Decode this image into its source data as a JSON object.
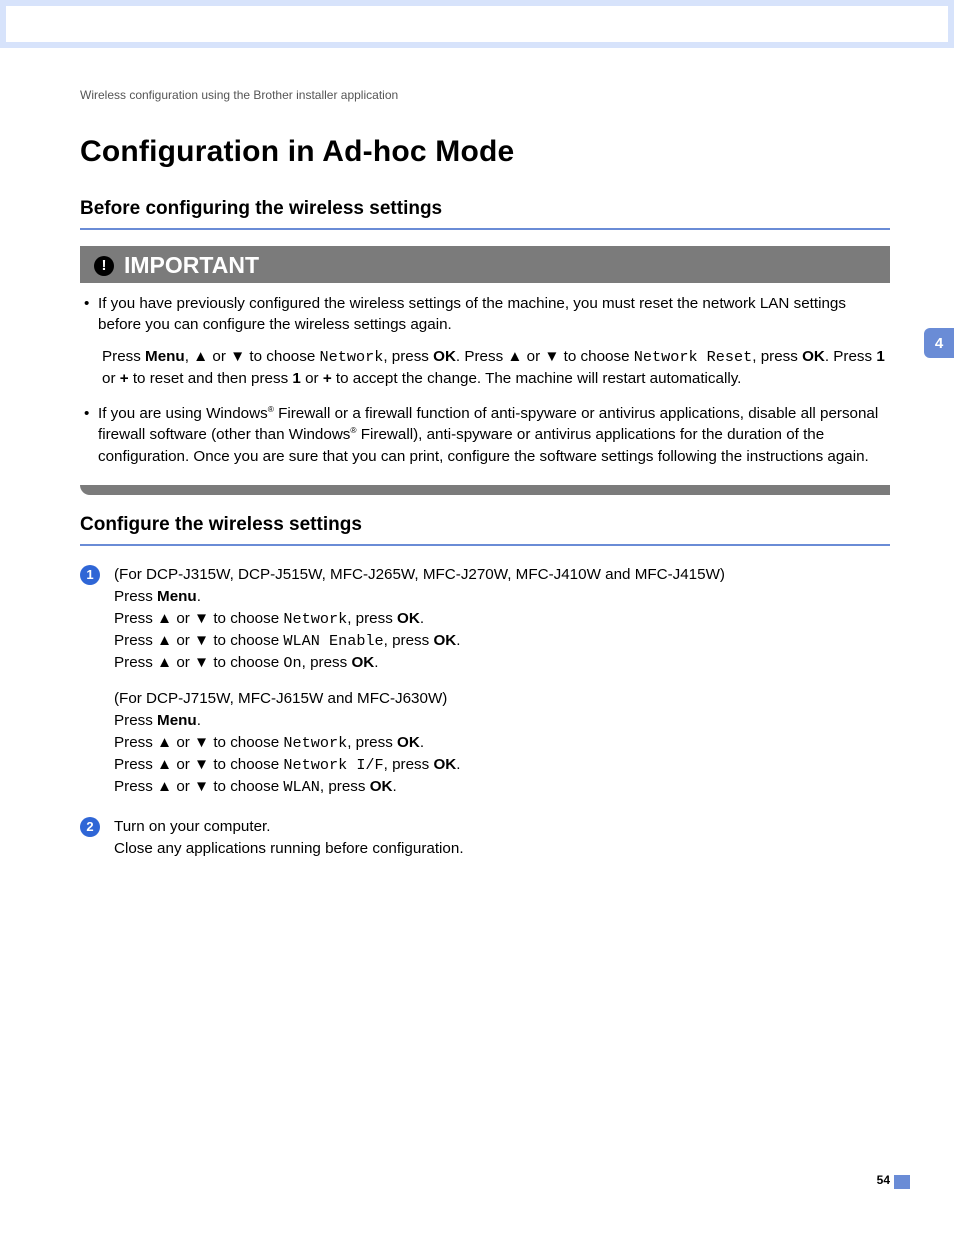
{
  "breadcrumb": "Wireless configuration using the Brother installer application",
  "title": "Configuration in Ad-hoc Mode",
  "section1_heading": "Before configuring the wireless settings",
  "important_label": "IMPORTANT",
  "bullets": {
    "b1_a": "If you have previously configured the wireless settings of the machine, you must reset the network LAN settings before you can configure the wireless settings again.",
    "b1_sub_pre1": "Press ",
    "b1_sub_menu": "Menu",
    "b1_sub_seg1": ", ",
    "b1_sub_seg2": " or ",
    "b1_sub_seg3": " to choose ",
    "b1_sub_network": "Network",
    "b1_sub_seg4": ", press ",
    "b1_sub_ok": "OK",
    "b1_sub_seg5": ". Press ",
    "b1_sub_seg6": " or ",
    "b1_sub_seg7": " to choose ",
    "b1_sub_reset": "Network Reset",
    "b1_sub_seg8": ", press ",
    "b1_sub_seg9": ". Press ",
    "b1_sub_one": "1",
    "b1_sub_seg10": " or ",
    "b1_sub_plus": "+",
    "b1_sub_seg11": " to reset and then press ",
    "b1_sub_seg12": " or ",
    "b1_sub_seg13": " to accept the change. The machine will restart automatically.",
    "b2_a": "If you are using Windows",
    "b2_b": " Firewall or a firewall function of anti-spyware or antivirus applications, disable all personal firewall software (other than Windows",
    "b2_c": " Firewall), anti-spyware or antivirus applications for the duration of the configuration. Once you are sure that you can print, configure the software settings following the instructions again."
  },
  "section2_heading": "Configure the wireless settings",
  "steps": {
    "s1": {
      "l1": "(For DCP-J315W, DCP-J515W, MFC-J265W, MFC-J270W, MFC-J410W and MFC-J415W)",
      "l2a": "Press ",
      "l2b": "Menu",
      "l2c": ".",
      "l3a": "Press ",
      "l3b": " or ",
      "l3c": " to choose ",
      "l3d": "Network",
      "l3e": ", press ",
      "l3f": "OK",
      "l3g": ".",
      "l4a": "Press ",
      "l4b": " or ",
      "l4c": " to choose ",
      "l4d": "WLAN Enable",
      "l4e": ", press ",
      "l4f": "OK",
      "l4g": ".",
      "l5a": "Press ",
      "l5b": " or ",
      "l5c": " to choose ",
      "l5d": "On",
      "l5e": ", press ",
      "l5f": "OK",
      "l5g": ".",
      "l6": "(For DCP-J715W, MFC-J615W and MFC-J630W)",
      "l7a": "Press ",
      "l7b": "Menu",
      "l7c": ".",
      "l8a": "Press ",
      "l8b": " or ",
      "l8c": " to choose ",
      "l8d": "Network",
      "l8e": ", press ",
      "l8f": "OK",
      "l8g": ".",
      "l9a": "Press ",
      "l9b": " or ",
      "l9c": " to choose ",
      "l9d": "Network I/F",
      "l9e": ", press ",
      "l9f": "OK",
      "l9g": ".",
      "l10a": "Press ",
      "l10b": " or ",
      "l10c": " to choose ",
      "l10d": "WLAN",
      "l10e": ", press ",
      "l10f": "OK",
      "l10g": "."
    },
    "s2": {
      "l1": "Turn on your computer.",
      "l2": "Close any applications running before configuration."
    }
  },
  "glyphs": {
    "up": "▲",
    "down": "▼",
    "reg": "®"
  },
  "side_tab": "4",
  "page_number": "54"
}
